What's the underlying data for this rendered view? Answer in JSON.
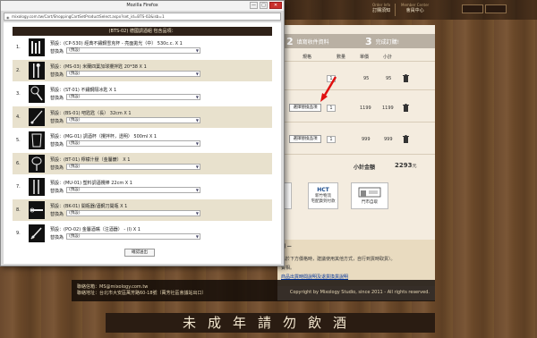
{
  "site": {
    "nav": [
      {
        "label": "訂購須知",
        "sub": "Order Info"
      },
      {
        "label": "會員中心",
        "sub": "Member Center"
      }
    ],
    "top_buttons": [
      "",
      ""
    ]
  },
  "popup": {
    "title": "Mozilla Firefox",
    "controls": [
      "—",
      "□",
      "✕"
    ],
    "url": "mixology.com.tw/Cart/ShoppingCartSetProductSelect.aspx?set_id=BTS-02&isb=1",
    "header": "(BTS-02) 德國調酒組 包含品項：",
    "items": [
      {
        "num": "1.",
        "desc": "預設：(CP-530) 經典不鏽鋼雪克杯 - 亮面拋光（中） 530c.c. X 1",
        "replace_label": "替換為",
        "select": "(預設)"
      },
      {
        "num": "2.",
        "desc": "預設：(MS-03) 米蘭四葉加球攪拌匙 20*38 X 1",
        "replace_label": "替換為",
        "select": "(預設)"
      },
      {
        "num": "3.",
        "desc": "預設：(ST-01) 不鏽鋼隔冰匙 X 1",
        "replace_label": "替換為",
        "select": "(預設)"
      },
      {
        "num": "4.",
        "desc": "預設：(BS-01) 吧匙匙（長） 32cm X 1",
        "replace_label": "替換為",
        "select": "(預設)"
      },
      {
        "num": "5.",
        "desc": "預設：(MG-01) 調酒杯（攪拌杯，透明） 500ml X 1",
        "replace_label": "替換為",
        "select": "(預設)"
      },
      {
        "num": "6.",
        "desc": "預設：(BT-01) 檸檬汁壓（金屬鍍） X 1",
        "replace_label": "替換為",
        "select": "(預設)"
      },
      {
        "num": "7.",
        "desc": "預設：(MU-01) 塑料調酒攪棒 22cm X 1",
        "replace_label": "替換為",
        "select": "(預設)"
      },
      {
        "num": "8.",
        "desc": "預設：(BK-01) 開瓶器/酒鋼刀開瓶 X 1",
        "replace_label": "替換為",
        "select": "(預設)"
      },
      {
        "num": "9.",
        "desc": "預設：(PO-02) 金屬酒嘴（注酒器） - (Ⅰ) X 1",
        "replace_label": "替換為",
        "select": "(預設)"
      }
    ],
    "confirm": "確認送出"
  },
  "cart": {
    "steps": [
      {
        "num": "2",
        "label": "填寫收件資料"
      },
      {
        "num": "3",
        "label": "完成訂購!"
      }
    ],
    "columns": {
      "spec": "規格",
      "qty": "數量",
      "price": "單價",
      "subtotal": "小計"
    },
    "rows": [
      {
        "qty": "1",
        "price": "95",
        "subtotal": "95",
        "button": ""
      },
      {
        "qty": "1",
        "price": "1199",
        "subtotal": "1199",
        "button": "選擇替換品項"
      },
      {
        "qty": "1",
        "price": "999",
        "subtotal": "999",
        "button": "選擇替換品項"
      }
    ],
    "subtotal_label": "小計金額",
    "subtotal_value": "2293",
    "subtotal_unit": "元",
    "payment": [
      {
        "label": "",
        "sub": ""
      },
      {
        "label": "宅配貨到付款",
        "sub": "新竹物流"
      },
      {
        "label": "門市自取",
        "sub": ""
      }
    ],
    "notes": [
      "剩 —",
      "高於下方價格時，建議使用其他方式，自行到貨時取貨）。",
      "賣相。",
      "商品出貨時間說明及退貨換貨說明"
    ]
  },
  "footer": {
    "email": "聯絡信箱：MS@mixology.com.tw",
    "address": "聯絡地址：台北市大安區萬芳路60-18號（萬芳社區會議站出口）",
    "copyright": "Copyright by Mixology Studio, since 2011 - All rights reserved."
  },
  "warning": "未成年請勿飲酒"
}
